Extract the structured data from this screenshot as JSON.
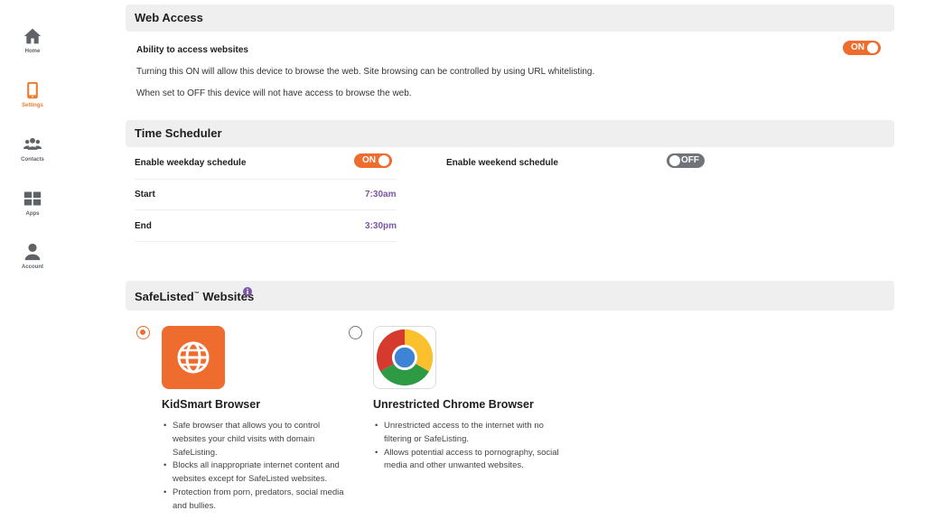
{
  "sidebar": {
    "items": [
      {
        "label": "Home",
        "icon": "home-icon"
      },
      {
        "label": "Settings",
        "icon": "phone-icon"
      },
      {
        "label": "Contacts",
        "icon": "contacts-icon"
      },
      {
        "label": "Apps",
        "icon": "apps-icon"
      },
      {
        "label": "Account",
        "icon": "account-icon"
      }
    ],
    "active": "Settings",
    "active_color": "#ee7b30"
  },
  "web_access": {
    "title": "Web Access",
    "ability_label": "Ability to access websites",
    "toggle_label": "ON",
    "desc_on": "Turning this ON will allow this device to browse the web. Site browsing can be controlled by using URL whitelisting.",
    "desc_off": "When set to OFF this device will not have access to browse the web."
  },
  "time_scheduler": {
    "title": "Time Scheduler",
    "weekday_label": "Enable weekday schedule",
    "weekday_toggle": "ON",
    "weekend_label": "Enable weekend schedule",
    "weekend_toggle": "OFF",
    "start_label": "Start",
    "start_time": "7:30am",
    "end_label": "End",
    "end_time": "3:30pm"
  },
  "safelisted": {
    "title": "SafeListed",
    "tm": "™",
    "title_suffix": " Websites",
    "info_icon": "info-icon",
    "options": [
      {
        "title": "KidSmart Browser",
        "selected": true,
        "icon": "globe-icon",
        "bullets": [
          "Safe browser that allows you to control websites your child visits with domain SafeListing.",
          "Blocks all inappropriate internet content and websites except for SafeListed websites.",
          "Protection from porn, predators, social media and bullies."
        ]
      },
      {
        "title": "Unrestricted Chrome Browser",
        "selected": false,
        "icon": "chrome-icon",
        "bullets": [
          "Unrestricted access to the internet with no filtering or SafeListing.",
          "Allows potential access to pornography, social media and other unwanted websites."
        ]
      }
    ]
  },
  "colors": {
    "accent": "#ee6c2e",
    "time": "#7b57a6",
    "header_bg": "#efefef",
    "toggle_off": "#707378"
  }
}
